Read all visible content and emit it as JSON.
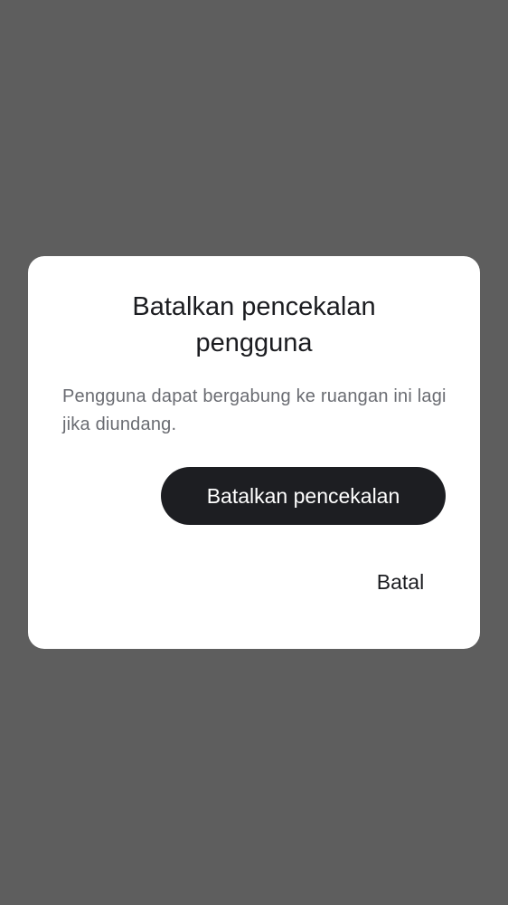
{
  "dialog": {
    "title": "Batalkan pencekalan pengguna",
    "message": "Pengguna dapat bergabung ke ruangan ini lagi jika diundang.",
    "confirm_label": "Batalkan pencekalan",
    "cancel_label": "Batal"
  },
  "colors": {
    "scrim": "#5e5e5e",
    "surface": "#ffffff",
    "primary": "#1d1e22",
    "on_primary": "#ffffff",
    "text_primary": "#1b1c20",
    "text_secondary": "#6a6c72"
  }
}
